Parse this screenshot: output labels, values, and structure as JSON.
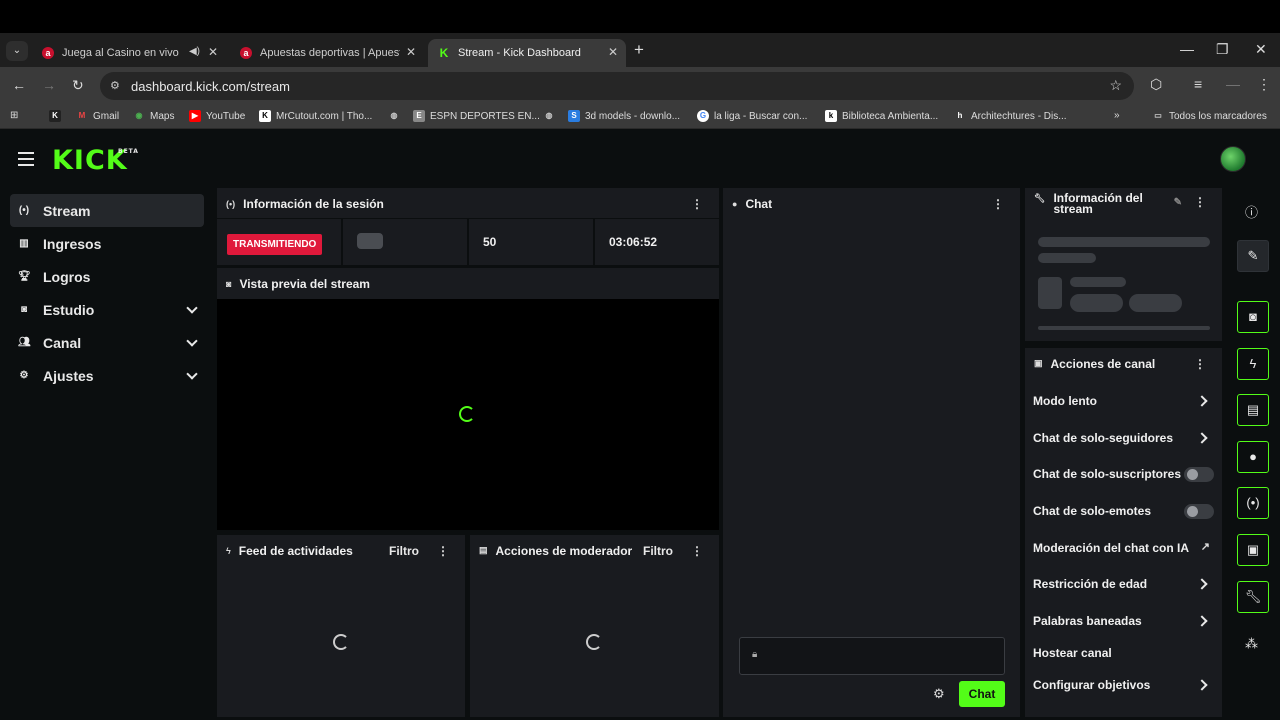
{
  "browser": {
    "tabs": [
      {
        "title": "Juega al Casino en vivo Onl",
        "favicon": "a"
      },
      {
        "title": "Apuestas deportivas | Apuestas",
        "favicon": "a"
      },
      {
        "title": "Stream - Kick Dashboard",
        "favicon": "K"
      }
    ],
    "url": "dashboard.kick.com/stream",
    "bookmarks": [
      "Gmail",
      "Maps",
      "YouTube",
      "MrCutout.com | Tho...",
      "ESPN DEPORTES EN...",
      "3d models - downlo...",
      "la liga - Buscar con...",
      "Biblioteca Ambienta...",
      "Architechtures - Dis..."
    ],
    "all_bookmarks": "Todos los marcadores"
  },
  "header": {
    "logo": "KICK",
    "beta": "BETA"
  },
  "sidebar": {
    "items": [
      {
        "label": "Stream",
        "icon": "broadcast-icon"
      },
      {
        "label": "Ingresos",
        "icon": "chart-icon"
      },
      {
        "label": "Logros",
        "icon": "trophy-icon"
      },
      {
        "label": "Estudio",
        "icon": "studio-icon"
      },
      {
        "label": "Canal",
        "icon": "users-icon"
      },
      {
        "label": "Ajustes",
        "icon": "gear-icon"
      }
    ]
  },
  "session": {
    "title": "Información de la sesión",
    "status": "TRANSMITIENDO",
    "viewers": "50",
    "duration": "03:06:52"
  },
  "preview": {
    "title": "Vista previa del stream"
  },
  "activity": {
    "title": "Feed de actividades",
    "filter": "Filtro"
  },
  "modactions": {
    "title": "Acciones de moderador",
    "filter": "Filtro"
  },
  "chat": {
    "title": "Chat",
    "send_label": "Chat"
  },
  "stream_info": {
    "title": "Información del stream"
  },
  "channel_actions": {
    "title": "Acciones de canal",
    "items": [
      {
        "label": "Modo lento",
        "type": "arrow"
      },
      {
        "label": "Chat de solo-seguidores",
        "type": "arrow"
      },
      {
        "label": "Chat de solo-suscriptores",
        "type": "toggle"
      },
      {
        "label": "Chat de solo-emotes",
        "type": "toggle"
      },
      {
        "label": "Moderación del chat con IA",
        "type": "external"
      },
      {
        "label": "Restricción de edad",
        "type": "arrow"
      },
      {
        "label": "Palabras baneadas",
        "type": "arrow"
      },
      {
        "label": "Hostear canal",
        "type": "none"
      },
      {
        "label": "Configurar objetivos",
        "type": "arrow"
      }
    ]
  },
  "colors": {
    "accent": "#53fc18",
    "live": "#e0193b",
    "panel": "#191b1f",
    "background": "#0b0e0f"
  }
}
